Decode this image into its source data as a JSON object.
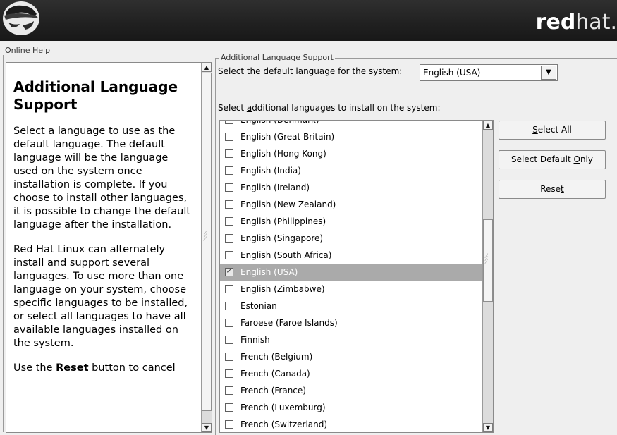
{
  "banner": {
    "brand_bold": "red",
    "brand_light": "hat.",
    "logo_icon": "redhat-shadowman-icon"
  },
  "help": {
    "frame_label": "Online Help",
    "title": "Additional Language Support",
    "paragraph1": "Select a language to use as the default language. The default language will be the language used on the system once installation is complete. If you choose to install other languages, it is possible to change the default language after the installation.",
    "paragraph2": "Red Hat Linux can alternately install and support several languages. To use more than one language on your system, choose specific languages to be installed, or select all languages to have all available languages installed on the system.",
    "paragraph3_pre": "Use the ",
    "paragraph3_bold": "Reset",
    "paragraph3_post": " button to cancel"
  },
  "section": {
    "frame_label": "Additional Language Support",
    "default_label_pre": "Select the ",
    "default_label_u": "d",
    "default_label_post": "efault language for the system:",
    "default_value": "English (USA)",
    "additional_label_pre": "Select ",
    "additional_label_u": "a",
    "additional_label_post": "dditional languages to install on the system:"
  },
  "languages": [
    {
      "name": "English (Denmark)",
      "checked": false,
      "selected": false
    },
    {
      "name": "English (Great Britain)",
      "checked": false,
      "selected": false
    },
    {
      "name": "English (Hong Kong)",
      "checked": false,
      "selected": false
    },
    {
      "name": "English (India)",
      "checked": false,
      "selected": false
    },
    {
      "name": "English (Ireland)",
      "checked": false,
      "selected": false
    },
    {
      "name": "English (New Zealand)",
      "checked": false,
      "selected": false
    },
    {
      "name": "English (Philippines)",
      "checked": false,
      "selected": false
    },
    {
      "name": "English (Singapore)",
      "checked": false,
      "selected": false
    },
    {
      "name": "English (South Africa)",
      "checked": false,
      "selected": false
    },
    {
      "name": "English (USA)",
      "checked": true,
      "selected": true
    },
    {
      "name": "English (Zimbabwe)",
      "checked": false,
      "selected": false
    },
    {
      "name": "Estonian",
      "checked": false,
      "selected": false
    },
    {
      "name": "Faroese (Faroe Islands)",
      "checked": false,
      "selected": false
    },
    {
      "name": "Finnish",
      "checked": false,
      "selected": false
    },
    {
      "name": "French (Belgium)",
      "checked": false,
      "selected": false
    },
    {
      "name": "French (Canada)",
      "checked": false,
      "selected": false
    },
    {
      "name": "French (France)",
      "checked": false,
      "selected": false
    },
    {
      "name": "French (Luxemburg)",
      "checked": false,
      "selected": false
    },
    {
      "name": "French (Switzerland)",
      "checked": false,
      "selected": false
    }
  ],
  "buttons": {
    "select_all_u": "S",
    "select_all_rest": "elect All",
    "select_default_pre": "Select Default ",
    "select_default_u": "O",
    "select_default_post": "nly",
    "reset_pre": "Rese",
    "reset_u": "t"
  }
}
